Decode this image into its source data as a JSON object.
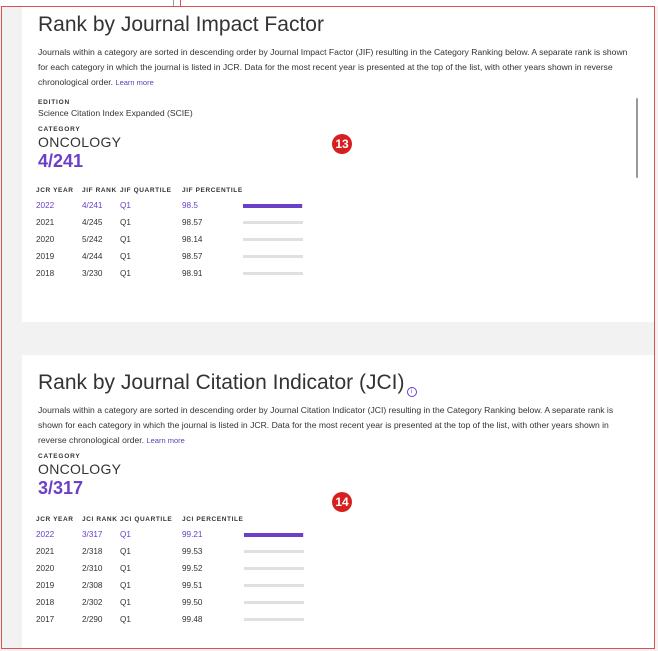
{
  "jif": {
    "title": "Rank by Journal Impact Factor",
    "description": "Journals within a category are sorted in descending order by Journal Impact Factor (JIF) resulting in the Category Ranking below. A separate rank is shown for each category in which the journal is listed in JCR. Data for the most recent year is presented at the top of the list, with other years shown in reverse chronological order.",
    "learn_more": "Learn more",
    "edition_label": "EDITION",
    "edition": "Science Citation Index Expanded (SCIE)",
    "category_label": "CATEGORY",
    "category": "ONCOLOGY",
    "rank": "4/241",
    "marker": "13",
    "headers": [
      "JCR YEAR",
      "JIF RANK",
      "JIF QUARTILE",
      "JIF PERCENTILE"
    ],
    "rows": [
      {
        "year": "2022",
        "rank": "4/241",
        "quartile": "Q1",
        "percentile": "98.5",
        "fill": 0.985
      },
      {
        "year": "2021",
        "rank": "4/245",
        "quartile": "Q1",
        "percentile": "98.57",
        "fill": 0.9857
      },
      {
        "year": "2020",
        "rank": "5/242",
        "quartile": "Q1",
        "percentile": "98.14",
        "fill": 0.9814
      },
      {
        "year": "2019",
        "rank": "4/244",
        "quartile": "Q1",
        "percentile": "98.57",
        "fill": 0.9857
      },
      {
        "year": "2018",
        "rank": "3/230",
        "quartile": "Q1",
        "percentile": "98.91",
        "fill": 0.9891
      }
    ]
  },
  "jci": {
    "title": "Rank by Journal Citation Indicator (JCI)",
    "info_icon": "info-icon",
    "description": "Journals within a category are sorted in descending order by Journal Citation Indicator (JCI) resulting in the Category Ranking below. A separate rank is shown for each category in which the journal is listed in JCR. Data for the most recent year is presented at the top of the list, with other years shown in reverse chronological order.",
    "learn_more": "Learn more",
    "category_label": "CATEGORY",
    "category": "ONCOLOGY",
    "rank": "3/317",
    "marker": "14",
    "headers": [
      "JCR YEAR",
      "JCI RANK",
      "JCI QUARTILE",
      "JCI PERCENTILE"
    ],
    "rows": [
      {
        "year": "2022",
        "rank": "3/317",
        "quartile": "Q1",
        "percentile": "99.21",
        "fill": 0.9921
      },
      {
        "year": "2021",
        "rank": "2/318",
        "quartile": "Q1",
        "percentile": "99.53",
        "fill": 0.9953
      },
      {
        "year": "2020",
        "rank": "2/310",
        "quartile": "Q1",
        "percentile": "99.52",
        "fill": 0.9952
      },
      {
        "year": "2019",
        "rank": "2/308",
        "quartile": "Q1",
        "percentile": "99.51",
        "fill": 0.9951
      },
      {
        "year": "2018",
        "rank": "2/302",
        "quartile": "Q1",
        "percentile": "99.50",
        "fill": 0.995
      },
      {
        "year": "2017",
        "rank": "2/290",
        "quartile": "Q1",
        "percentile": "99.48",
        "fill": 0.9948
      }
    ]
  },
  "colors": {
    "accent": "#6b3fc7",
    "marker": "#d71f1f",
    "track": "#e0e0e0"
  }
}
